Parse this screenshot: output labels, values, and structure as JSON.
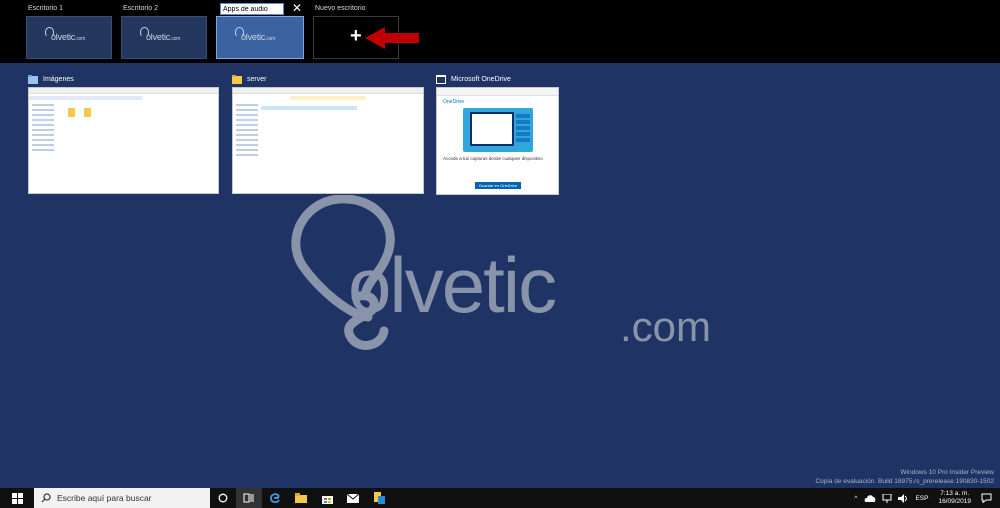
{
  "desktops": [
    {
      "label": "Escritorio 1"
    },
    {
      "label": "Escritorio 2"
    },
    {
      "label": "Apps de audio",
      "active": true
    },
    {
      "label": "Nuevo escritorio"
    }
  ],
  "thumb_logo": {
    "word": "olvetic",
    "dom": ".com"
  },
  "windows": [
    {
      "title": "Imágenes",
      "icon": "pictures-folder-icon"
    },
    {
      "title": "server",
      "icon": "folder-icon"
    },
    {
      "title": "Microsoft OneDrive",
      "icon": "app-window-icon"
    }
  ],
  "onedrive_preview": {
    "brand": "OneDrive",
    "heading": "Accede a tus capturas desde cualquier dispositivo",
    "button": "Guardar en OneDrive"
  },
  "brand": {
    "word": "olvetic",
    "dom": ".com"
  },
  "build_watermark": {
    "line1": "Windows 10 Pro Insider Preview",
    "line2": "Copia de evaluación. Build 18975.rs_prerelease.190830-1502"
  },
  "taskbar": {
    "search_placeholder": "Escribe aquí para buscar",
    "language": "ESP",
    "time": "7:13 a. m.",
    "date": "16/09/2019"
  },
  "colors": {
    "desktop_bg": "#1f3464",
    "active_desk": "#3b63a0",
    "arrow": "#c00000",
    "taskbar": "#101010"
  }
}
